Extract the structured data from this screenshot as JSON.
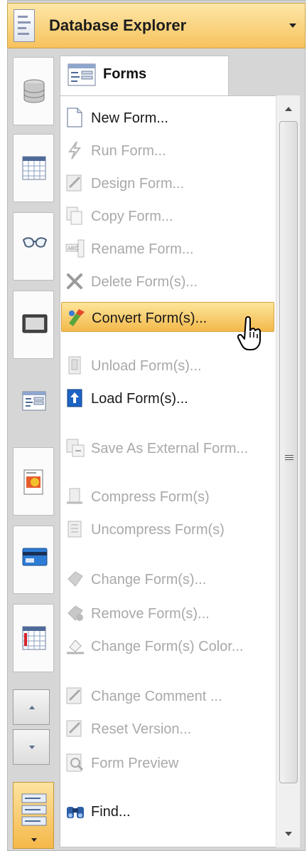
{
  "header": {
    "title": "Database Explorer"
  },
  "tab": {
    "label": "Forms"
  },
  "menu": {
    "items": [
      {
        "label": "New Form...",
        "enabled": true,
        "icon": "new-form-icon"
      },
      {
        "label": "Run Form...",
        "enabled": false,
        "icon": "run-form-icon"
      },
      {
        "label": "Design Form...",
        "enabled": false,
        "icon": "design-form-icon"
      },
      {
        "label": "Copy Form...",
        "enabled": false,
        "icon": "copy-form-icon"
      },
      {
        "label": "Rename Form...",
        "enabled": false,
        "icon": "rename-form-icon"
      },
      {
        "label": "Delete Form(s)...",
        "enabled": false,
        "icon": "delete-icon"
      },
      {
        "label": "Convert Form(s)...",
        "enabled": true,
        "icon": "convert-icon",
        "hover": true
      },
      {
        "label": "Unload Form(s)...",
        "enabled": false,
        "icon": "unload-icon"
      },
      {
        "label": "Load Form(s)...",
        "enabled": true,
        "icon": "load-icon"
      },
      {
        "label": "Save  As  External  Form...",
        "enabled": false,
        "icon": "save-external-icon"
      },
      {
        "label": "Compress Form(s)",
        "enabled": false,
        "icon": "compress-icon"
      },
      {
        "label": "Uncompress Form(s)",
        "enabled": false,
        "icon": "uncompress-icon"
      },
      {
        "label": "Change  Form(s)...",
        "enabled": false,
        "icon": "change-form-icon"
      },
      {
        "label": "Remove  Form(s)...",
        "enabled": false,
        "icon": "remove-form-icon"
      },
      {
        "label": "Change Form(s) Color...",
        "enabled": false,
        "icon": "color-icon"
      },
      {
        "label": "Change Comment ...",
        "enabled": false,
        "icon": "comment-icon"
      },
      {
        "label": "Reset  Version...",
        "enabled": false,
        "icon": "reset-version-icon"
      },
      {
        "label": "Form Preview",
        "enabled": false,
        "icon": "preview-icon"
      },
      {
        "label": "Find...",
        "enabled": true,
        "icon": "binoculars-icon"
      }
    ]
  },
  "rail": {
    "buttons": [
      "database-icon",
      "table-icon",
      "glasses-icon",
      "tablet-icon",
      "forms-icon",
      "report-icon",
      "card-icon",
      "grid-alert-icon"
    ]
  },
  "colors": {
    "hover_top": "#fde59a",
    "hover_bottom": "#f3b94b",
    "header_bg": "#f7c25d"
  }
}
